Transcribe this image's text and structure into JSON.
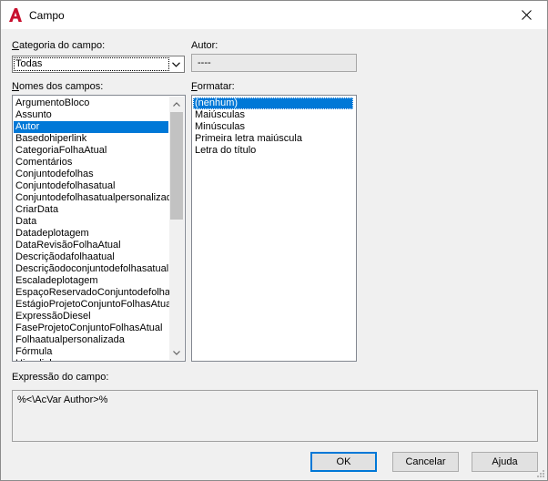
{
  "window": {
    "title": "Campo",
    "close_glyph": "✕"
  },
  "category": {
    "label": "Categoria do campo:",
    "value": "Todas"
  },
  "author": {
    "label": "Autor:",
    "value": "----"
  },
  "field_names": {
    "label": "Nomes dos campos:",
    "selected_index": 2,
    "items": [
      "ArgumentoBloco",
      "Assunto",
      "Autor",
      "Basedohiperlink",
      "CategoriaFolhaAtual",
      "Comentários",
      "Conjuntodefolhas",
      "Conjuntodefolhasatual",
      "Conjuntodefolhasatualpersonalizad",
      "CriarData",
      "Data",
      "Datadeplotagem",
      "DataRevisãoFolhaAtual",
      "Descriçãodafolhaatual",
      "Descriçãodoconjuntodefolhasatual",
      "Escaladeplotagem",
      "EspaçoReservadoConjuntodefolhas",
      "EstágioProjetoConjuntoFolhasAtual",
      "ExpressãoDiesel",
      "FaseProjetoConjuntoFolhasAtual",
      "Folhaatualpersonalizada",
      "Fórmula",
      "Hiperlink"
    ]
  },
  "format": {
    "label": "Formatar:",
    "selected_index": 0,
    "items": [
      "(nenhum)",
      "Maiúsculas",
      "Minúsculas",
      "Primeira letra maiúscula",
      "Letra do título"
    ]
  },
  "expression": {
    "label": "Expressão do campo:",
    "value": "%<\\AcVar Author>%"
  },
  "buttons": {
    "ok": "OK",
    "cancel": "Cancelar",
    "help": "Ajuda"
  },
  "colors": {
    "selection": "#0078d7",
    "app_icon": "#c8102e"
  }
}
